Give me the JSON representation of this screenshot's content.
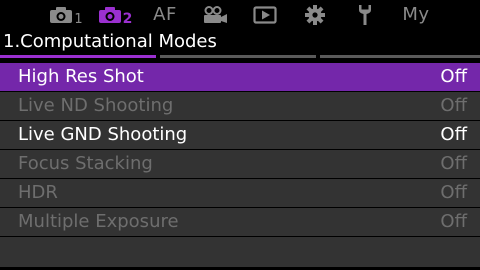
{
  "colors": {
    "accent": "#9b30d0",
    "selected_row": "#7427aa",
    "row_bg": "#333333",
    "disabled_text": "#6e6e6e",
    "inactive_tab": "#8a8a8a"
  },
  "tabs": [
    {
      "icon": "camera-icon",
      "subscript": "1",
      "active": false
    },
    {
      "icon": "camera-icon",
      "subscript": "2",
      "active": true
    },
    {
      "label": "AF",
      "active": false
    },
    {
      "icon": "video-camera-icon",
      "active": false
    },
    {
      "icon": "playback-icon",
      "active": false
    },
    {
      "icon": "gear-icon",
      "active": false
    },
    {
      "icon": "wrench-icon",
      "active": false
    },
    {
      "label": "My",
      "active": false
    }
  ],
  "section": {
    "title": "1.Computational Modes"
  },
  "menu": {
    "items": [
      {
        "label": "High Res Shot",
        "value": "Off",
        "state": "selected"
      },
      {
        "label": "Live ND Shooting",
        "value": "Off",
        "state": "disabled"
      },
      {
        "label": "Live GND Shooting",
        "value": "Off",
        "state": "enabled"
      },
      {
        "label": "Focus Stacking",
        "value": "Off",
        "state": "disabled"
      },
      {
        "label": "HDR",
        "value": "Off",
        "state": "disabled"
      },
      {
        "label": "Multiple Exposure",
        "value": "Off",
        "state": "disabled"
      }
    ]
  }
}
